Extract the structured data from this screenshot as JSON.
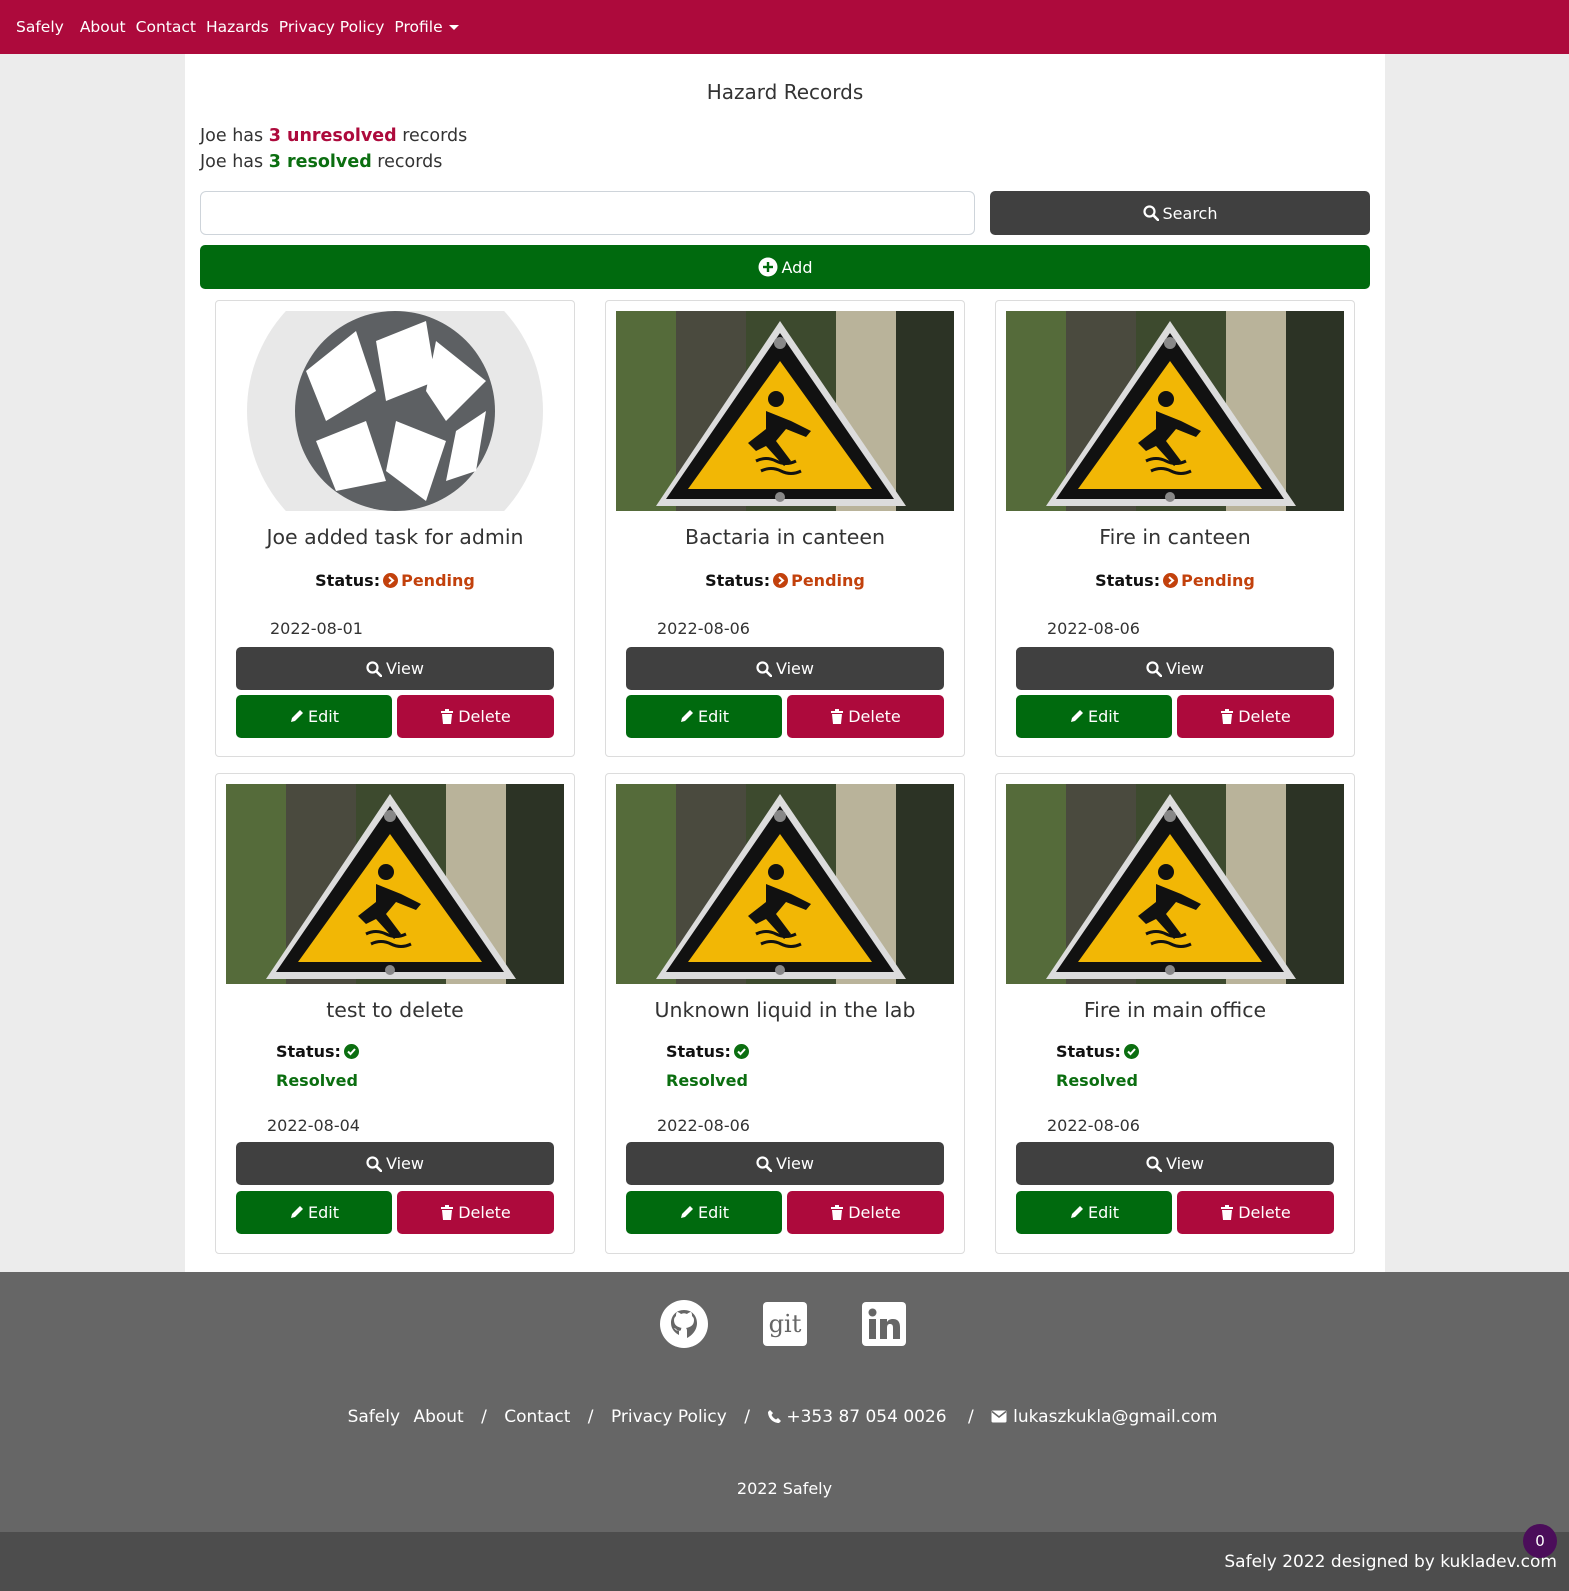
{
  "nav": {
    "brand": "Safely",
    "items": [
      "About",
      "Contact",
      "Hazards",
      "Privacy Policy"
    ],
    "profile": "Profile"
  },
  "main": {
    "title": "Hazard Records",
    "summary": {
      "prefix1": "Joe has ",
      "unresolved_count": "3",
      "unresolved_word": "unresolved",
      "suffix1": " records",
      "prefix2": "Joe has ",
      "resolved_count": "3",
      "resolved_word": "resolved",
      "suffix2": " records"
    },
    "search_placeholder": "",
    "search_label": "Search",
    "add_label": "Add"
  },
  "cards": [
    {
      "title": "Joe added task for admin",
      "status_label": "Status:",
      "status": "Pending",
      "date": "2022-08-01",
      "image": "logo-placeholder"
    },
    {
      "title": "Bactaria in canteen",
      "status_label": "Status:",
      "status": "Pending",
      "date": "2022-08-06",
      "image": "hazard-sign"
    },
    {
      "title": "Fire in canteen",
      "status_label": "Status:",
      "status": "Pending",
      "date": "2022-08-06",
      "image": "hazard-sign"
    },
    {
      "title": "test to delete",
      "status_label": "Status:",
      "status": "Resolved",
      "date": "2022-08-04",
      "image": "hazard-sign"
    },
    {
      "title": "Unknown liquid in the lab",
      "status_label": "Status:",
      "status": "Resolved",
      "date": "2022-08-06",
      "image": "hazard-sign"
    },
    {
      "title": "Fire in main office",
      "status_label": "Status:",
      "status": "Resolved",
      "date": "2022-08-06",
      "image": "hazard-sign"
    }
  ],
  "card_actions": {
    "view": "View",
    "edit": "Edit",
    "delete": "Delete"
  },
  "footer": {
    "social": [
      "github-icon",
      "git-icon",
      "linkedin-icon"
    ],
    "git_text": "git",
    "links": [
      "Safely",
      "About",
      "Contact",
      "Privacy Policy"
    ],
    "phone": "+353 87 054 0026",
    "email": "lukaszkukla@gmail.com",
    "copyright": "2022 Safely",
    "designed_by": "Safely 2022 designed by kukladev.com",
    "badge_count": "0"
  },
  "colors": {
    "brand": "#ad0a3c",
    "success": "#006a0e",
    "dark": "#404040",
    "pending": "#c2410c",
    "footer": "#666666"
  }
}
